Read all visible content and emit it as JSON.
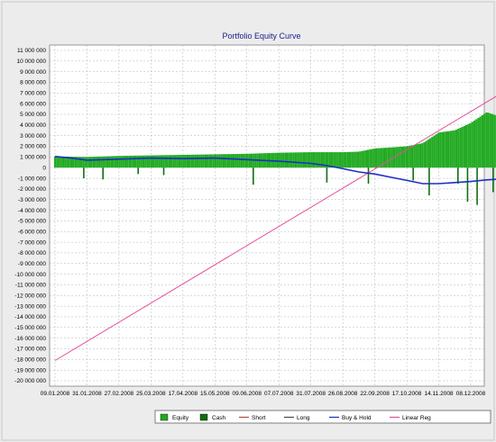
{
  "chart_data": {
    "type": "bar",
    "title": "Portfolio Equity Curve",
    "xlabel": "",
    "ylabel": "",
    "ylim": [
      -20000000,
      11000000
    ],
    "grid": true,
    "legend_position": "bottom",
    "y_ticks": [
      11000000,
      10000000,
      9000000,
      8000000,
      7000000,
      6000000,
      5000000,
      4000000,
      3000000,
      2000000,
      1000000,
      0,
      -1000000,
      -2000000,
      -3000000,
      -4000000,
      -5000000,
      -6000000,
      -7000000,
      -8000000,
      -9000000,
      -10000000,
      -11000000,
      -12000000,
      -13000000,
      -14000000,
      -15000000,
      -16000000,
      -17000000,
      -18000000,
      -19000000,
      -20000000
    ],
    "y_tick_labels": [
      "11 000 000",
      "10 000 000",
      "9 000 000",
      "8 000 000",
      "7 000 000",
      "6 000 000",
      "5 000 000",
      "4 000 000",
      "3 000 000",
      "2 000 000",
      "1 000 000",
      "0",
      "-1 000 000",
      "-2 000 000",
      "-3 000 000",
      "-4 000 000",
      "-5 000 000",
      "-6 000 000",
      "-7 000 000",
      "-8 000 000",
      "-9 000 000",
      "-10 000 000",
      "-11 000 000",
      "-12 000 000",
      "-13 000 000",
      "-14 000 000",
      "-15 000 000",
      "-16 000 000",
      "-17 000 000",
      "-18 000 000",
      "-19 000 000",
      "-20 000 000"
    ],
    "x_tick_labels": [
      "09.01.2008",
      "31.01.2008",
      "27.02.2008",
      "25.03.2008",
      "17.04.2008",
      "15.05.2008",
      "09.06.2008",
      "07.07.2008",
      "31.07.2008",
      "26.08.2008",
      "22.09.2008",
      "17.10.2008",
      "14.11.2008",
      "08.12.2008"
    ],
    "x_range": [
      0,
      13.8
    ],
    "series": [
      {
        "name": "Equity",
        "type": "bar",
        "x": [
          0,
          1,
          2,
          3,
          4,
          5,
          6,
          7,
          8,
          9,
          9.5,
          10,
          10.5,
          11,
          11.5,
          12,
          12.5,
          13,
          13.5,
          13.8
        ],
        "values": [
          1050000,
          1000000,
          1100000,
          1150000,
          1200000,
          1250000,
          1300000,
          1400000,
          1450000,
          1450000,
          1500000,
          1800000,
          1900000,
          2000000,
          2300000,
          3300000,
          3500000,
          4200000,
          5200000,
          4900000
        ]
      },
      {
        "name": "Cash",
        "type": "bar",
        "x": [
          0.9,
          1.5,
          2.6,
          3.4,
          6.2,
          8.5,
          9.8,
          11.2,
          11.7,
          12.6,
          12.9,
          13.2,
          13.7
        ],
        "values": [
          -1000000,
          -1100000,
          -600000,
          -700000,
          -1600000,
          -1400000,
          -1500000,
          -1200000,
          -2600000,
          -1500000,
          -3200000,
          -3500000,
          -2300000
        ]
      },
      {
        "name": "Short",
        "type": "line",
        "x": [],
        "values": []
      },
      {
        "name": "Long",
        "type": "line",
        "x": [],
        "values": []
      },
      {
        "name": "Buy & Hold",
        "type": "line",
        "x": [
          0,
          0.5,
          1,
          2,
          3,
          4,
          5,
          6,
          7,
          8,
          8.5,
          9,
          9.5,
          10,
          10.5,
          11,
          11.5,
          12,
          12.5,
          13,
          13.5,
          13.8
        ],
        "values": [
          1050000,
          900000,
          700000,
          800000,
          900000,
          850000,
          900000,
          750000,
          600000,
          400000,
          200000,
          -100000,
          -400000,
          -600000,
          -900000,
          -1200000,
          -1500000,
          -1500000,
          -1400000,
          -1300000,
          -1150000,
          -1100000
        ]
      },
      {
        "name": "Linear Reg",
        "type": "line",
        "x": [
          0,
          13.8
        ],
        "values": [
          -18100000,
          6700000
        ]
      }
    ]
  }
}
